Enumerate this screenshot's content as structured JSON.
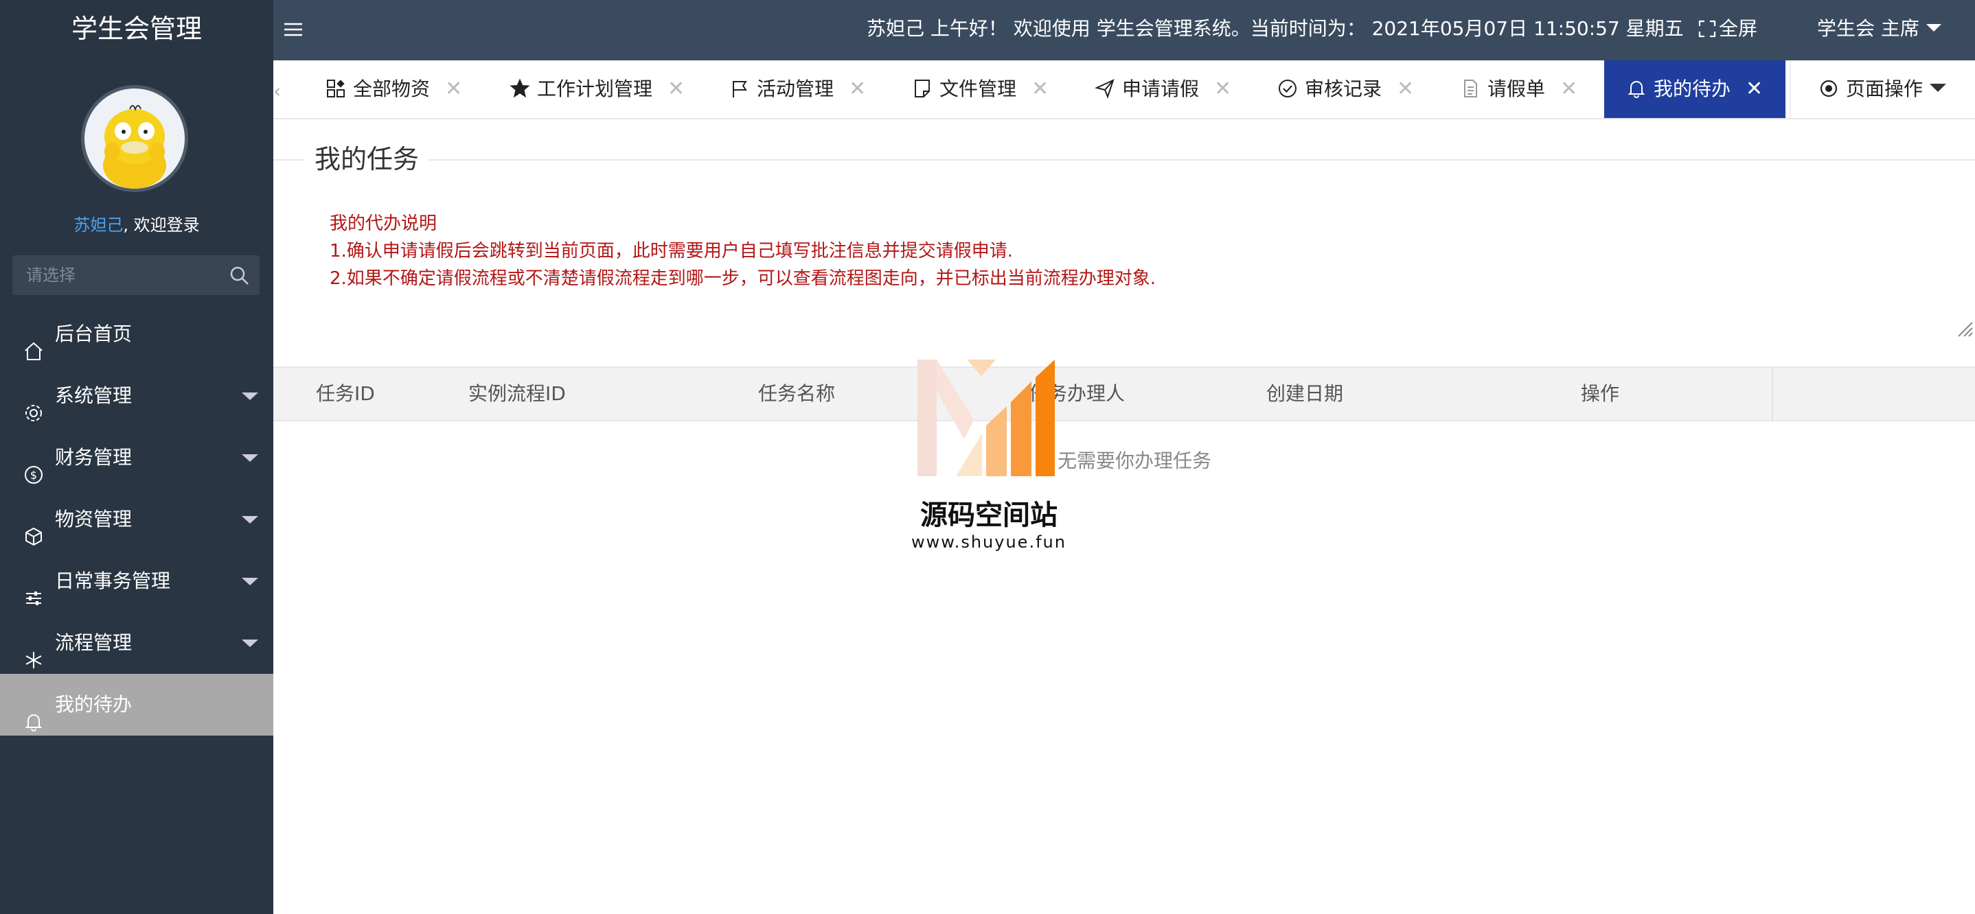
{
  "sidebar": {
    "brand": "学生会管理",
    "user_name": "苏妲己",
    "welcome_suffix": ", 欢迎登录",
    "search_placeholder": "请选择",
    "items": [
      {
        "label": "后台首页",
        "icon": "home-icon"
      },
      {
        "label": "系统管理",
        "icon": "gear-icon"
      },
      {
        "label": "财务管理",
        "icon": "dollar-icon"
      },
      {
        "label": "物资管理",
        "icon": "cube-icon"
      },
      {
        "label": "日常事务管理",
        "icon": "sliders-icon"
      },
      {
        "label": "流程管理",
        "icon": "snowflake-icon"
      },
      {
        "label": "我的待办",
        "icon": "bell-icon"
      }
    ]
  },
  "header": {
    "greeting": "苏妲己 上午好！ 欢迎使用 学生会管理系统。当前时间为： 2021年05月07日 11:50:57   星期五",
    "fullscreen_label": "全屏",
    "user_menu_label": "学生会 主席"
  },
  "tabs": [
    {
      "label": "全部物资",
      "icon": "grid-icon"
    },
    {
      "label": "工作计划管理",
      "icon": "star-icon"
    },
    {
      "label": "活动管理",
      "icon": "flag-icon"
    },
    {
      "label": "文件管理",
      "icon": "note-icon"
    },
    {
      "label": "申请请假",
      "icon": "send-icon"
    },
    {
      "label": "审核记录",
      "icon": "check-circle-icon"
    },
    {
      "label": "请假单",
      "icon": "document-icon"
    },
    {
      "label": "我的待办",
      "icon": "bell-icon",
      "active": true
    }
  ],
  "tab_close_glyph": "✕",
  "tab_scroll_left": "‹",
  "page_ops_label": "页面操作",
  "main": {
    "title": "我的任务",
    "notes": [
      "我的代办说明",
      "1.确认申请请假后会跳转到当前页面，此时需要用户自己填写批注信息并提交请假申请.",
      "2.如果不确定请假流程或不清楚请假流程走到哪一步，可以查看流程图走向，并已标出当前流程办理对象."
    ],
    "table": {
      "columns": [
        "任务ID",
        "实例流程ID",
        "任务名称",
        "任务办理人",
        "创建日期",
        "操作"
      ],
      "empty_text": "无需要你办理任务"
    }
  },
  "watermark": {
    "title": "源码空间站",
    "url": "www.shuyue.fun"
  },
  "colors": {
    "sidebar_bg": "#2a3543",
    "topbar_bg": "#3a4b5f",
    "active_tab_bg": "#1f3e9e",
    "notes_red": "#b31616",
    "active_menu_bg": "#a9a9a9"
  }
}
